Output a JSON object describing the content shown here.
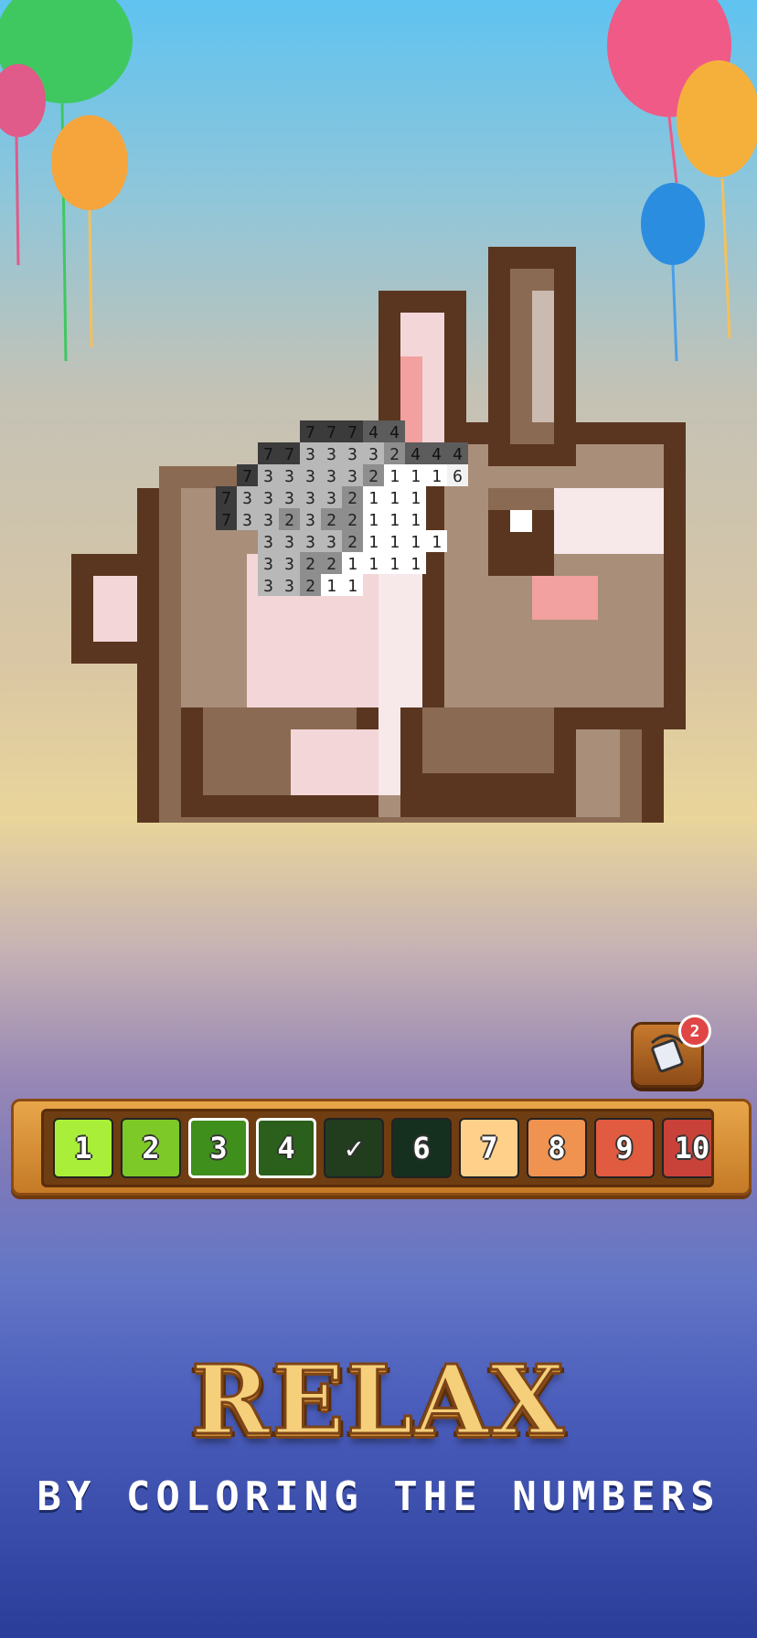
{
  "palette": {
    "swatches": [
      {
        "label": "1",
        "color": "#a9ef3a",
        "state": "normal"
      },
      {
        "label": "2",
        "color": "#7dc928",
        "state": "normal"
      },
      {
        "label": "3",
        "color": "#3f8f1d",
        "state": "selected"
      },
      {
        "label": "4",
        "color": "#2b5f1c",
        "state": "selected"
      },
      {
        "label": "✓",
        "color": "#213d1e",
        "state": "completed"
      },
      {
        "label": "6",
        "color": "#163020",
        "state": "normal"
      },
      {
        "label": "7",
        "color": "#ffd08a",
        "state": "normal"
      },
      {
        "label": "8",
        "color": "#f09250",
        "state": "normal"
      },
      {
        "label": "9",
        "color": "#e05b3f",
        "state": "normal"
      },
      {
        "label": "10",
        "color": "#c8423a",
        "state": "normal"
      }
    ]
  },
  "bucket": {
    "icon": "paint-bucket-icon",
    "badge": "2"
  },
  "headline": {
    "title": "RELAX",
    "subtitle": "BY COLORING THE NUMBERS"
  },
  "puzzle": {
    "number_rows": [
      "7 7 7 4 4",
      "7 7 3 3 3 3 2 4 4 4",
      "7 3 3 3 3 3 2 1 1 1 6",
      "7 3 3 3 3 3 2 1 1 1",
      "7 3 3 2 3 2 2 1 1 1",
      "3 3 3 3 2 1 1 1 1",
      "3 3 2 2 1 1 1 1",
      "3 3 2 1 1"
    ]
  }
}
